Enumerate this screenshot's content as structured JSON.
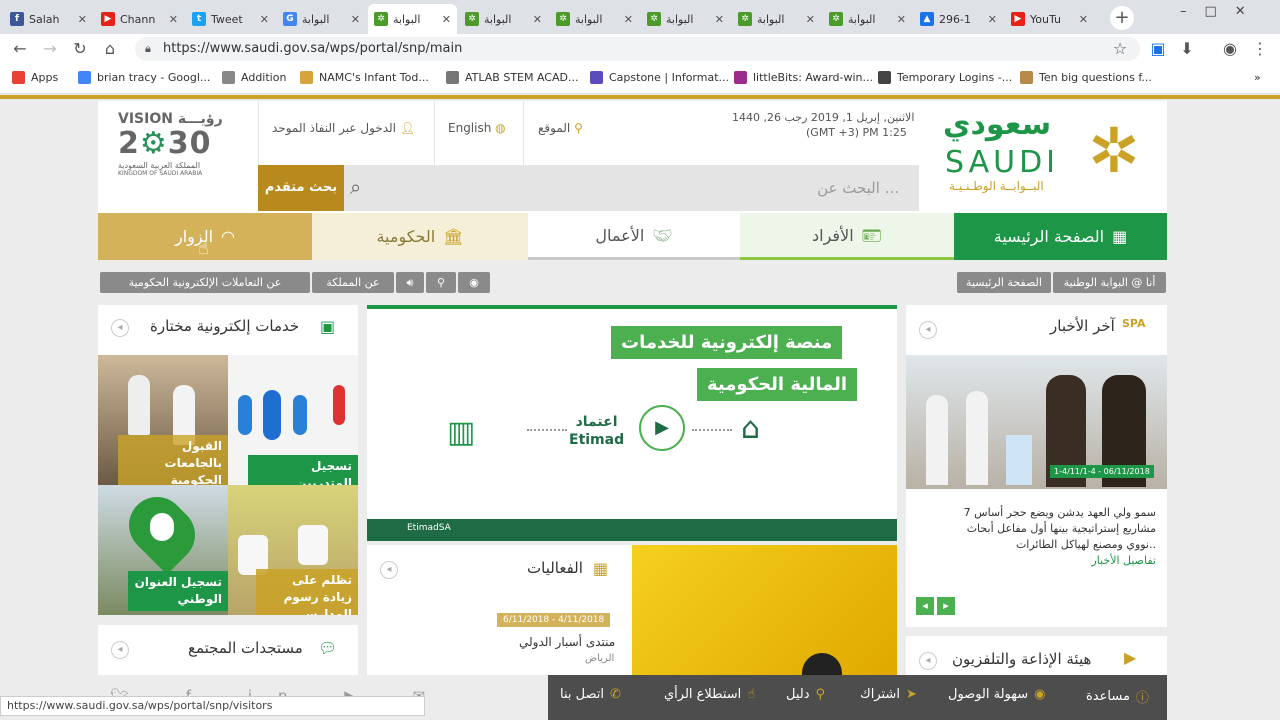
{
  "browser": {
    "tabs": [
      {
        "title": "Salah",
        "favicon_color": "#3b5998",
        "favicon_char": "f"
      },
      {
        "title": "Chann",
        "favicon_color": "#e62117",
        "favicon_char": "▶"
      },
      {
        "title": "Tweet",
        "favicon_color": "#1da1f2",
        "favicon_char": "t"
      },
      {
        "title": "البوابة",
        "favicon_color": "#4285f4",
        "favicon_char": "G"
      },
      {
        "title": "البوابة",
        "favicon_color": "#4c9a2a",
        "favicon_char": "✲",
        "active": true
      },
      {
        "title": "البوابة",
        "favicon_color": "#4c9a2a",
        "favicon_char": "✲"
      },
      {
        "title": "البوابة",
        "favicon_color": "#4c9a2a",
        "favicon_char": "✲"
      },
      {
        "title": "البوابة",
        "favicon_color": "#4c9a2a",
        "favicon_char": "✲"
      },
      {
        "title": "البوابة",
        "favicon_color": "#4c9a2a",
        "favicon_char": "✲"
      },
      {
        "title": "البوابة",
        "favicon_color": "#4c9a2a",
        "favicon_char": "✲"
      },
      {
        "title": "296-1",
        "favicon_color": "#1a73e8",
        "favicon_char": "▲"
      },
      {
        "title": "YouTu",
        "favicon_color": "#e62117",
        "favicon_char": "▶"
      }
    ],
    "url": "https://www.saudi.gov.sa/wps/portal/snp/main",
    "bookmarks": [
      {
        "label": "Apps"
      },
      {
        "label": "brian tracy - Googl..."
      },
      {
        "label": "Addition"
      },
      {
        "label": "NAMC's Infant Tod..."
      },
      {
        "label": "ATLAB STEM ACAD..."
      },
      {
        "label": "Capstone | Informat..."
      },
      {
        "label": "littleBits: Award-win..."
      },
      {
        "label": "Temporary Logins -..."
      },
      {
        "label": "Ten big questions f..."
      }
    ],
    "status_url": "https://www.saudi.gov.sa/wps/portal/snp/visitors"
  },
  "header": {
    "vision_text": "VISION 2030",
    "vision_ar": "رؤيـــة",
    "kingdom_ar": "المملكة العربية السعودية",
    "kingdom_en": "KINGDOM OF SAUDI ARABIA",
    "sso_login": "الدخول عبر النفاذ الموحد",
    "english": "English",
    "location": "الموقع",
    "date_line": "الاثنين, إبريل 1, 2019 رجب 26, 1440",
    "time_line": "(GMT +3) PM 1:25",
    "search_placeholder": "البحث عن ...",
    "advanced_search": "بحث متقدم",
    "logo_ar": "سعودي",
    "logo_en": "SAUDI",
    "logo_sub": "البــوابــة الوطـنـيـة"
  },
  "main_nav": [
    {
      "label": "الصفحة الرئيسية"
    },
    {
      "label": "الأفراد"
    },
    {
      "label": "الأعمال"
    },
    {
      "label": "الحكومية"
    },
    {
      "label": "الزوار"
    }
  ],
  "subbar": {
    "left": [
      "عن التعاملات الإلكترونية الحكومية",
      "عن المملكة"
    ],
    "right": [
      "أنا @ البوابة الوطنية",
      "الصفحة الرئيسية"
    ]
  },
  "eservices": {
    "title": "خدمات إلكترونية مختارة",
    "tiles": [
      "القبول بالجامعات الحكومية",
      "تسجيل المتدربين",
      "تسجيل العنوان الوطني",
      "تظلم على زيادة رسوم المدارس"
    ]
  },
  "community": {
    "title": "مستجدات المجتمع"
  },
  "banner": {
    "line1": "منصة إلكترونية للخدمات",
    "line2": "المالية الحكومية",
    "brand_ar": "اعتماد",
    "brand_en": "Etimad",
    "social": "EtimadSA"
  },
  "events": {
    "title": "الفعاليات",
    "date_range": "6/11/2018 - 4/11/2018",
    "event_name": "منتدى أسبار الدولي",
    "event_place": "الرياض"
  },
  "news": {
    "title": "آخر الأخبار",
    "date_badge": "1-4/11/1-4 - 06/11/2018",
    "text_lines": [
      "سمو ولي العهد يدشن ويضع حجر أساس 7",
      "مشاريع إستراتيجية بينها أول مفاعل أبحاث",
      "نووي ومصنع لهياكل الطائرات.."
    ],
    "more": "تفاصيل الأخبار"
  },
  "broadcast": {
    "title": "هيئة الإذاعة والتلفزيون"
  },
  "footer": [
    "مساعدة",
    "سهولة الوصول",
    "اشتراك",
    "دليل",
    "استطلاع الرأي",
    "اتصل بنا"
  ],
  "colors": {
    "green": "#1e9648",
    "gold": "#c9a227",
    "dark_green": "#1f6b46"
  }
}
